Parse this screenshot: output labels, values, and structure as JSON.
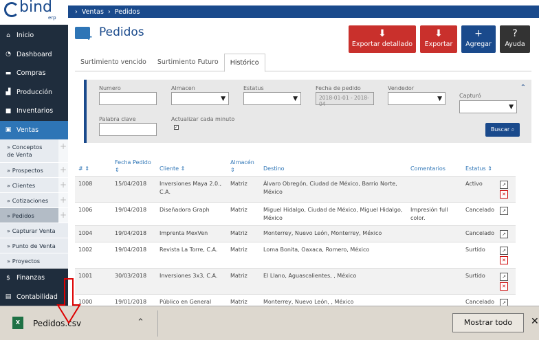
{
  "sidebar": {
    "logo": "bind",
    "logo_sub": "erp",
    "items": [
      {
        "label": "Inicio",
        "icon": "home-icon"
      },
      {
        "label": "Dashboard",
        "icon": "dashboard-icon"
      },
      {
        "label": "Compras",
        "icon": "cart-icon"
      },
      {
        "label": "Producción",
        "icon": "factory-icon"
      },
      {
        "label": "Inventarios",
        "icon": "truck-icon"
      },
      {
        "label": "Ventas",
        "icon": "sales-icon"
      }
    ],
    "subitems": [
      "» Conceptos de Venta",
      "» Prospectos",
      "» Clientes",
      "» Cotizaciones",
      "» Pedidos",
      "» Capturar Venta",
      "» Punto de Venta",
      "» Proyectos"
    ],
    "items2": [
      {
        "label": "Finanzas",
        "icon": "dollar-icon"
      },
      {
        "label": "Contabilidad",
        "icon": "accounting-icon"
      }
    ]
  },
  "breadcrumb": [
    "Ventas",
    "Pedidos"
  ],
  "page_title": "Pedidos",
  "actions": [
    {
      "label": "Exportar detallado",
      "color": "#c9302c"
    },
    {
      "label": "Exportar",
      "color": "#c9302c"
    },
    {
      "label": "Agregar",
      "color": "#1a4a8c"
    },
    {
      "label": "Ayuda",
      "color": "#333333"
    }
  ],
  "tabs": [
    "Surtimiento vencido",
    "Surtimiento Futuro",
    "Histórico"
  ],
  "filters": {
    "numero": "Numero",
    "almacen": "Almacen",
    "estatus": "Estatus",
    "fecha": "Fecha de pedido",
    "fecha_value": "2018-01-01 - 2018-04",
    "vendedor": "Vendedor",
    "capturo": "Capturó",
    "palabra": "Palabra clave",
    "actualizar": "Actualizar cada minuto",
    "buscar": "Buscar"
  },
  "table": {
    "headers": [
      "# ⇕",
      "Fecha Pedido ⇕",
      "Cliente ⇕",
      "Almacén ⇕",
      "Destino",
      "Comentarios",
      "Estatus ⇕"
    ],
    "rows": [
      {
        "num": "1008",
        "fecha": "15/04/2018",
        "cliente": "Inversiones Maya 2.0., C.A.",
        "almacen": "Matriz",
        "destino": "Álvaro Obregón, Ciudad de México, Barrio Norte, México",
        "comentarios": "",
        "estatus": "Activo"
      },
      {
        "num": "1006",
        "fecha": "19/04/2018",
        "cliente": "Diseñadora Graph",
        "almacen": "Matriz",
        "destino": "Miguel Hidalgo, Ciudad de México, Miguel Hidalgo, México",
        "comentarios": "Impresión full color.",
        "estatus": "Cancelado"
      },
      {
        "num": "1004",
        "fecha": "19/04/2018",
        "cliente": "Imprenta MexVen",
        "almacen": "Matriz",
        "destino": "Monterrey, Nuevo León, Monterrey, México",
        "comentarios": "",
        "estatus": "Cancelado"
      },
      {
        "num": "1002",
        "fecha": "19/04/2018",
        "cliente": "Revista La Torre, C.A.",
        "almacen": "Matriz",
        "destino": "Loma Bonita, Oaxaca, Romero, México",
        "comentarios": "",
        "estatus": "Surtido"
      },
      {
        "num": "1001",
        "fecha": "30/03/2018",
        "cliente": "Inversiones 3x3, C.A.",
        "almacen": "Matriz",
        "destino": "El Llano, Aguascalientes, , México",
        "comentarios": "",
        "estatus": "Surtido"
      },
      {
        "num": "1000",
        "fecha": "19/01/2018",
        "cliente": "Público en General",
        "almacen": "Matriz",
        "destino": "Monterrey, Nuevo León, , México",
        "comentarios": "",
        "estatus": "Cancelado"
      }
    ]
  },
  "download": {
    "filename": "Pedidos.csv",
    "show_all": "Mostrar todo"
  }
}
